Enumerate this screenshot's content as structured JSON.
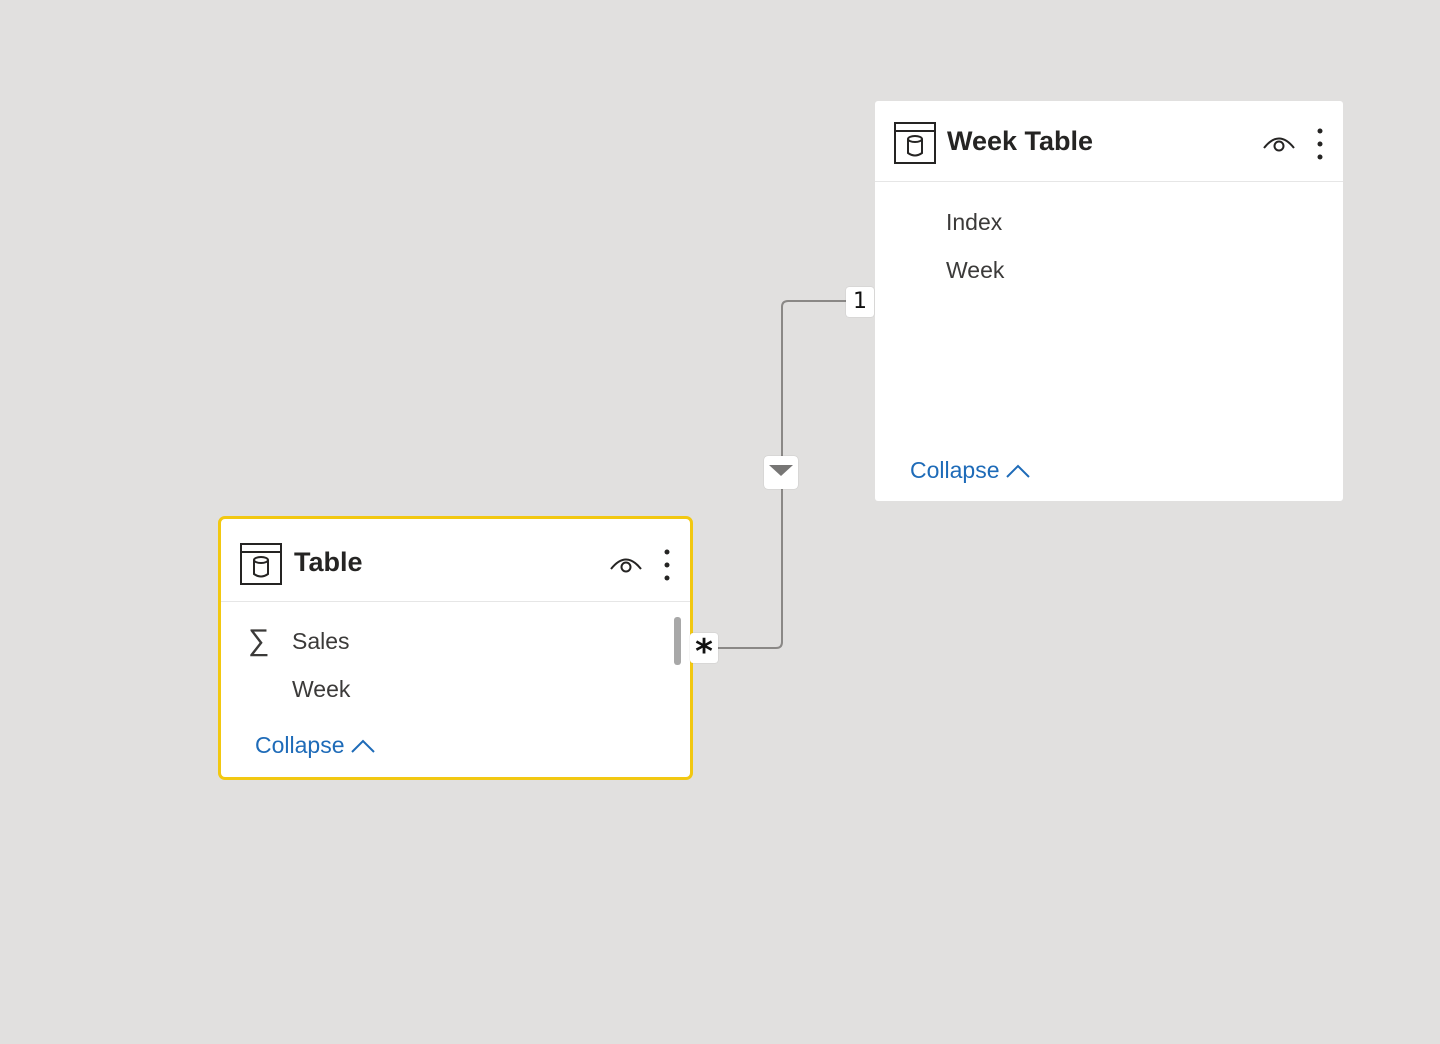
{
  "canvas": {
    "background": "#e1e0df"
  },
  "tables": [
    {
      "name": "Week Table",
      "selected": false,
      "icon": "table-icon",
      "fields": [
        {
          "label": "Index",
          "icon": null
        },
        {
          "label": "Week",
          "icon": null
        }
      ],
      "collapse_label": "Collapse"
    },
    {
      "name": "Table",
      "selected": true,
      "icon": "table-icon",
      "fields": [
        {
          "label": "Sales",
          "icon": "sigma-icon",
          "icon_glyph": "∑"
        },
        {
          "label": "Week",
          "icon": null
        }
      ],
      "collapse_label": "Collapse"
    }
  ],
  "relationship": {
    "from_table": "Table",
    "to_table": "Week Table",
    "one_side_label": "1",
    "many_side_label": "*",
    "cross_filter_icon": "filter-direction-arrow-icon"
  },
  "colors": {
    "selection_border": "#f2c811",
    "link_color": "#1e6bb8",
    "connector_line": "#8a8886"
  }
}
